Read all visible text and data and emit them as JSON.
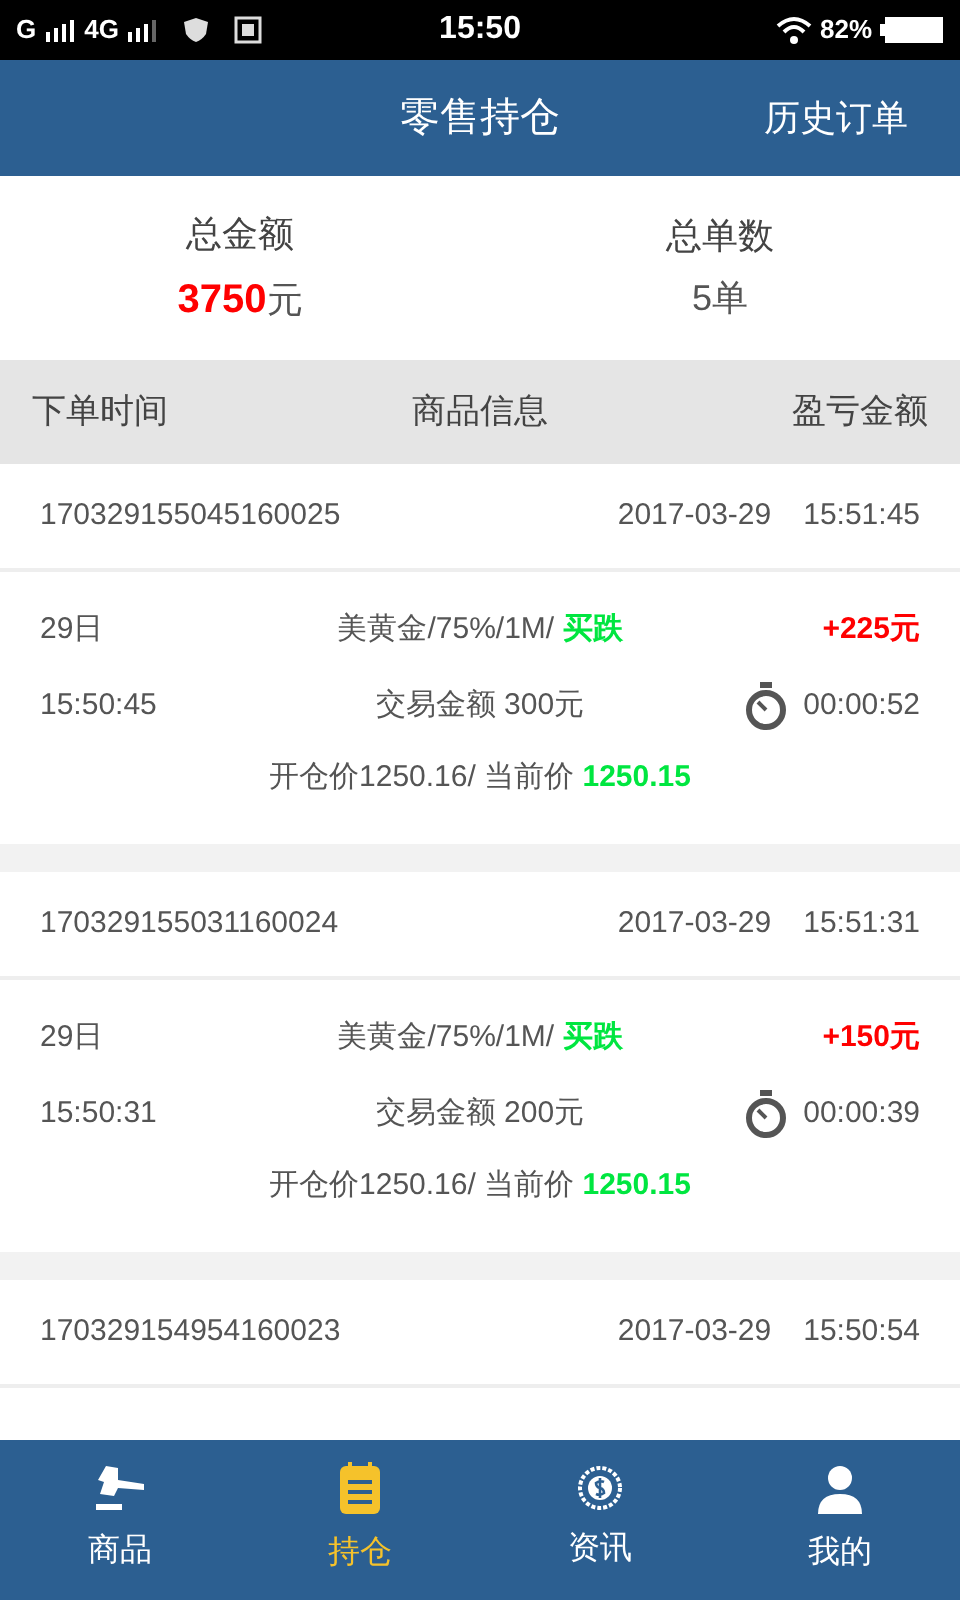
{
  "status_bar": {
    "network_1": "G",
    "network_2": "4G",
    "time": "15:50",
    "battery": "82%"
  },
  "header": {
    "title": "零售持仓",
    "action": "历史订单"
  },
  "summary": [
    {
      "label": "总金额",
      "value": "3750",
      "unit": "元"
    },
    {
      "label": "总单数",
      "value": "5单"
    }
  ],
  "table": {
    "columns": [
      "下单时间",
      "商品信息",
      "盈亏金额"
    ]
  },
  "orders": [
    {
      "order_no": "170329155045160025",
      "date": "2017-03-29",
      "time": "15:51:45",
      "day": "29日",
      "open_time": "15:50:45",
      "product": "美黄金/75%/1M/",
      "direction": "买跌",
      "profit": "+225元",
      "color": "#ff0000",
      "amount": "交易金额 300元",
      "duration": "00:00:52",
      "open_price": "开仓价1250.16/ 当前价",
      "current_price": "1250.15"
    },
    {
      "order_no": "170329155031160024",
      "date": "2017-03-29",
      "time": "15:51:31",
      "day": "29日",
      "open_time": "15:50:31",
      "product": "美黄金/75%/1M/",
      "direction": "买跌",
      "profit": "+150元",
      "color": "#ff0000",
      "amount": "交易金额 200元",
      "duration": "00:00:39",
      "open_price": "开仓价1250.16/ 当前价",
      "current_price": "1250.15"
    },
    {
      "order_no": "170329154954160023",
      "date": "2017-03-29",
      "time": "15:50:54"
    }
  ],
  "nav": [
    {
      "label": "商品",
      "kind": "gavel",
      "selected": false
    },
    {
      "label": "持仓",
      "kind": "notepad",
      "selected": true
    },
    {
      "label": "资讯",
      "kind": "coin",
      "selected": false
    },
    {
      "label": "我的",
      "kind": "person",
      "selected": false
    }
  ]
}
